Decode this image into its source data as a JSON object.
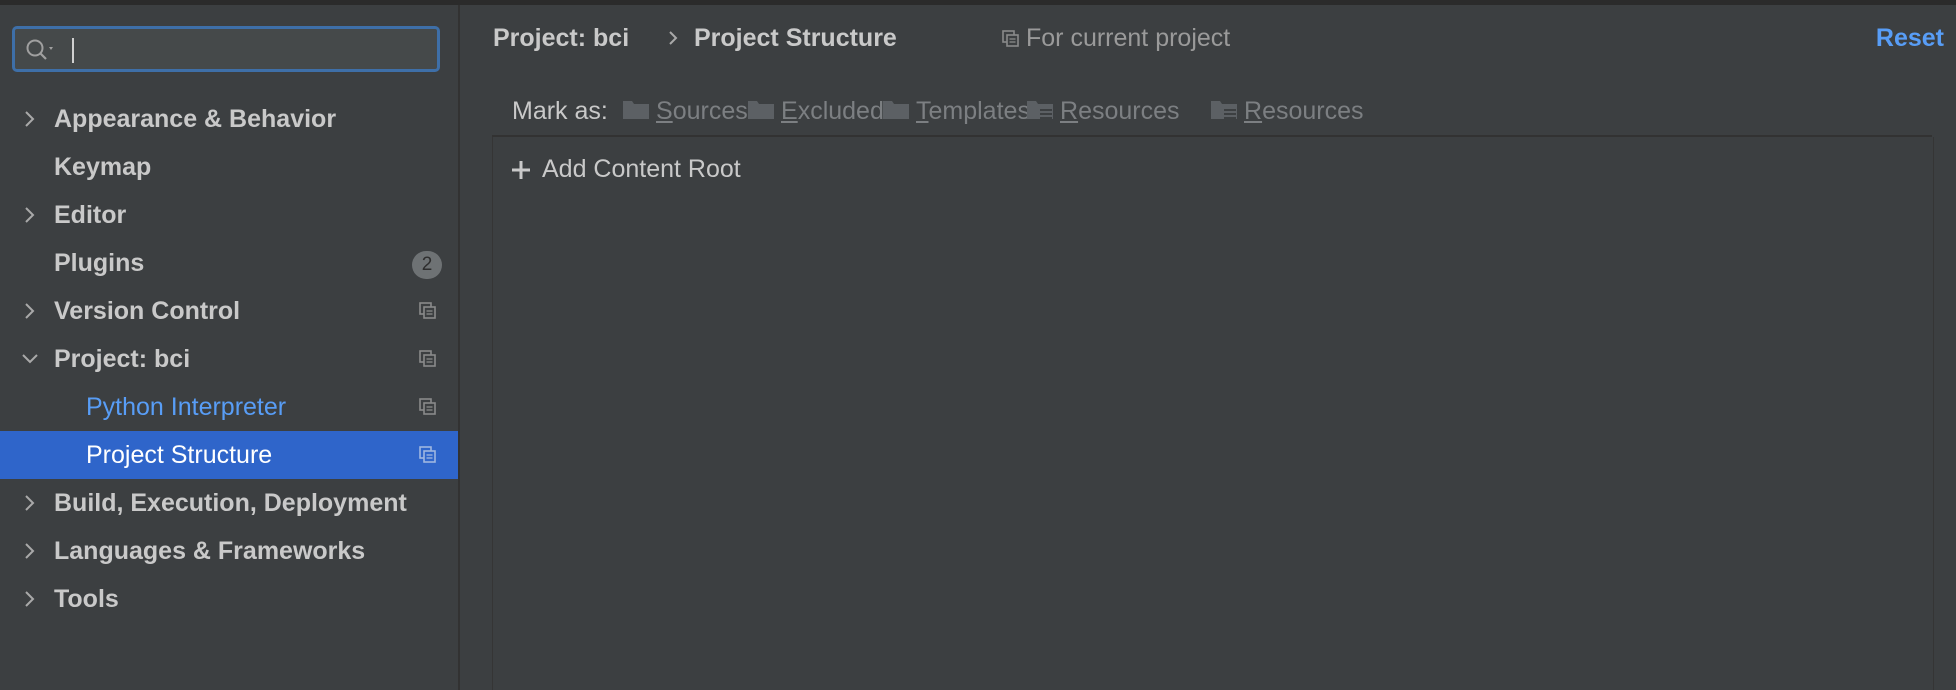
{
  "search": {
    "value": "",
    "placeholder": ""
  },
  "sidebar": {
    "items": [
      {
        "label": "Appearance & Behavior",
        "expand": "collapsed"
      },
      {
        "label": "Keymap"
      },
      {
        "label": "Editor",
        "expand": "collapsed"
      },
      {
        "label": "Plugins",
        "badge": "2"
      },
      {
        "label": "Version Control",
        "expand": "collapsed",
        "project_icon": true
      },
      {
        "label": "Project: bci",
        "expand": "expanded",
        "project_icon": true
      },
      {
        "label": "Python Interpreter",
        "project_icon": true
      },
      {
        "label": "Project Structure",
        "project_icon": true,
        "selected": true
      },
      {
        "label": "Build, Execution, Deployment",
        "expand": "collapsed"
      },
      {
        "label": "Languages & Frameworks",
        "expand": "collapsed"
      },
      {
        "label": "Tools",
        "expand": "collapsed"
      }
    ]
  },
  "header": {
    "breadcrumb": [
      "Project: bci",
      "Project Structure"
    ],
    "scope_label": "For current project",
    "reset_label": "Reset"
  },
  "toolbar": {
    "mark_as_label": "Mark as:",
    "buttons": [
      "Sources",
      "Excluded",
      "Templates",
      "Resources",
      "Resources"
    ]
  },
  "content": {
    "add_root_label": "Add Content Root"
  },
  "colors": {
    "accent": "#589df6",
    "selection": "#2f65ca",
    "background": "#3c3f41"
  }
}
